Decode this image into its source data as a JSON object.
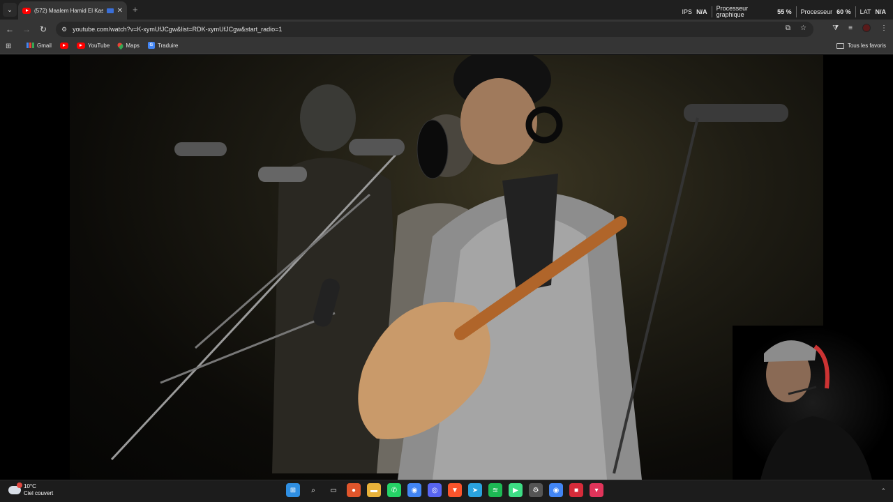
{
  "browser": {
    "tab": {
      "title": "(572) Maalem Hamid El Kas",
      "close": "✕"
    },
    "new_tab": "+",
    "performance": {
      "fps_label": "IPS",
      "fps_value": "N/A",
      "gpu_label_line1": "Processeur",
      "gpu_label_line2": "graphique",
      "gpu_value": "55 %",
      "cpu_label": "Processeur",
      "cpu_value": "60 %",
      "lat_label": "LAT",
      "lat_value": "N/A"
    },
    "address_bar": {
      "url": "youtube.com/watch?v=K-xymUfJCgw&list=RDK-xymUfJCgw&start_radio=1"
    },
    "bookmarks": {
      "items": [
        {
          "label": "Gmail",
          "icon": "gmail-icon"
        },
        {
          "label": "",
          "icon": "youtube-icon"
        },
        {
          "label": "YouTube",
          "icon": "youtube-icon"
        },
        {
          "label": "Maps",
          "icon": "maps-icon"
        },
        {
          "label": "Traduire",
          "icon": "translate-icon"
        }
      ],
      "all_bookmarks": "Tous les favoris"
    }
  },
  "taskbar": {
    "weather": {
      "temperature": "10°C",
      "condition": "Ciel couvert"
    },
    "apps": [
      {
        "name": "windows-start",
        "color": "#2f8fe3",
        "glyph": "⊞"
      },
      {
        "name": "search",
        "color": "transparent",
        "glyph": "⌕"
      },
      {
        "name": "task-view",
        "color": "transparent",
        "glyph": "▭"
      },
      {
        "name": "app-orange",
        "color": "#e0552b",
        "glyph": "●"
      },
      {
        "name": "file-explorer",
        "color": "#e8b23a",
        "glyph": "▬"
      },
      {
        "name": "whatsapp",
        "color": "#25d366",
        "glyph": "✆"
      },
      {
        "name": "chrome",
        "color": "#4285f4",
        "glyph": "◉"
      },
      {
        "name": "discord",
        "color": "#5865f2",
        "glyph": "◎"
      },
      {
        "name": "brave",
        "color": "#fb542b",
        "glyph": "▼"
      },
      {
        "name": "telegram",
        "color": "#2aa3de",
        "glyph": "➤"
      },
      {
        "name": "spotify",
        "color": "#1db954",
        "glyph": "≋"
      },
      {
        "name": "android-studio",
        "color": "#3ddc84",
        "glyph": "▶"
      },
      {
        "name": "steam",
        "color": "#555",
        "glyph": "⚙"
      },
      {
        "name": "chrome-profile",
        "color": "#4285f4",
        "glyph": "◉"
      },
      {
        "name": "app-red",
        "color": "#d62b3a",
        "glyph": "■"
      },
      {
        "name": "app-pink",
        "color": "#e0345a",
        "glyph": "▾"
      }
    ]
  }
}
